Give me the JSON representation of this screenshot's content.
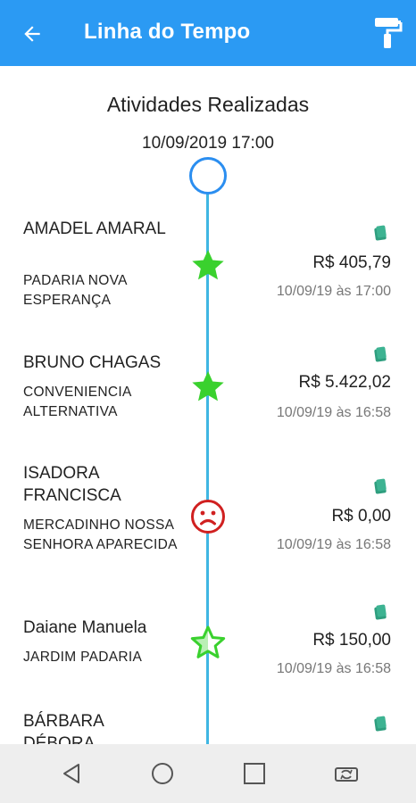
{
  "header": {
    "title": "Linha do Tempo",
    "back_icon": "arrow-back-icon",
    "action_icon": "paint-roller-icon"
  },
  "timeline": {
    "heading": "Atividades Realizadas",
    "date": "10/09/2019 17:00",
    "line_color": "#3fb6e3",
    "entries": [
      {
        "name": "AMADEL AMARAL",
        "store": "PADARIA NOVA ESPERANÇA",
        "amount": "R$ 405,79",
        "time": "10/09/19 às 17:00",
        "status_icon": "star-filled-icon"
      },
      {
        "name": "BRUNO CHAGAS",
        "store": "CONVENIENCIA ALTERNATIVA",
        "amount": "R$ 5.422,02",
        "time": "10/09/19 às 16:58",
        "status_icon": "star-filled-icon"
      },
      {
        "name": "ISADORA FRANCISCA",
        "store": "MERCADINHO NOSSA SENHORA APARECIDA",
        "amount": "R$ 0,00",
        "time": "10/09/19 às 16:58",
        "status_icon": "sad-face-icon"
      },
      {
        "name": "Daiane Manuela",
        "store": "JARDIM PADARIA",
        "amount": "R$ 150,00",
        "time": "10/09/19 às 16:58",
        "status_icon": "star-half-icon"
      },
      {
        "name": "BÁRBARA DÉBORA",
        "store": "",
        "amount": "",
        "time": "",
        "status_icon": ""
      }
    ]
  },
  "colors": {
    "appbar": "#2b9af3",
    "star": "#3ad12e",
    "sad": "#d02020",
    "money": "#2e9e7e"
  },
  "navbar": {
    "back_icon": "nav-back-icon",
    "home_icon": "nav-home-icon",
    "recents_icon": "nav-recents-icon",
    "rotate_icon": "rotate-screen-icon"
  }
}
